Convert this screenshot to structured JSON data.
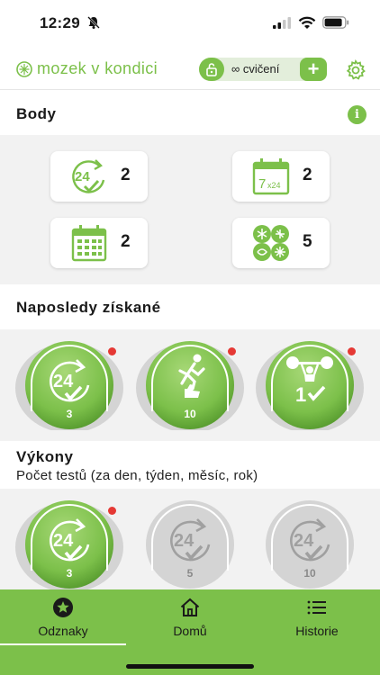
{
  "status": {
    "time": "12:29"
  },
  "header": {
    "brand": "mozek v kondici",
    "exercise_count": "∞ cvičení",
    "plus_label": "+"
  },
  "body_section": {
    "title": "Body",
    "info_label": "i",
    "stats": [
      {
        "icon": "day-24-icon",
        "value": "2"
      },
      {
        "icon": "calendar-7x24-icon",
        "value": "2"
      },
      {
        "icon": "calendar-month-icon",
        "value": "2"
      },
      {
        "icon": "brain-cells-icon",
        "value": "5"
      }
    ]
  },
  "recent": {
    "title": "Naposledy získané",
    "badges": [
      {
        "icon": "24-check-icon",
        "count": "3"
      },
      {
        "icon": "runner-thumbs-up-icon",
        "count": "10"
      },
      {
        "icon": "weightlifter-1-icon",
        "count": ""
      }
    ]
  },
  "performance": {
    "title": "Výkony",
    "subtitle": "Počet testů (za den, týden, měsíc, rok)",
    "badges": [
      {
        "count": "3",
        "active": true
      },
      {
        "count": "5",
        "active": false
      },
      {
        "count": "10",
        "active": false
      }
    ]
  },
  "tabs": [
    {
      "label": "Odznaky",
      "icon": "star-badge-icon",
      "active": true
    },
    {
      "label": "Domů",
      "icon": "home-icon",
      "active": false
    },
    {
      "label": "Historie",
      "icon": "list-icon",
      "active": false
    }
  ],
  "colors": {
    "accent": "#7cc04a",
    "badge_inactive": "#d4d4d4",
    "notification": "#e53935"
  }
}
